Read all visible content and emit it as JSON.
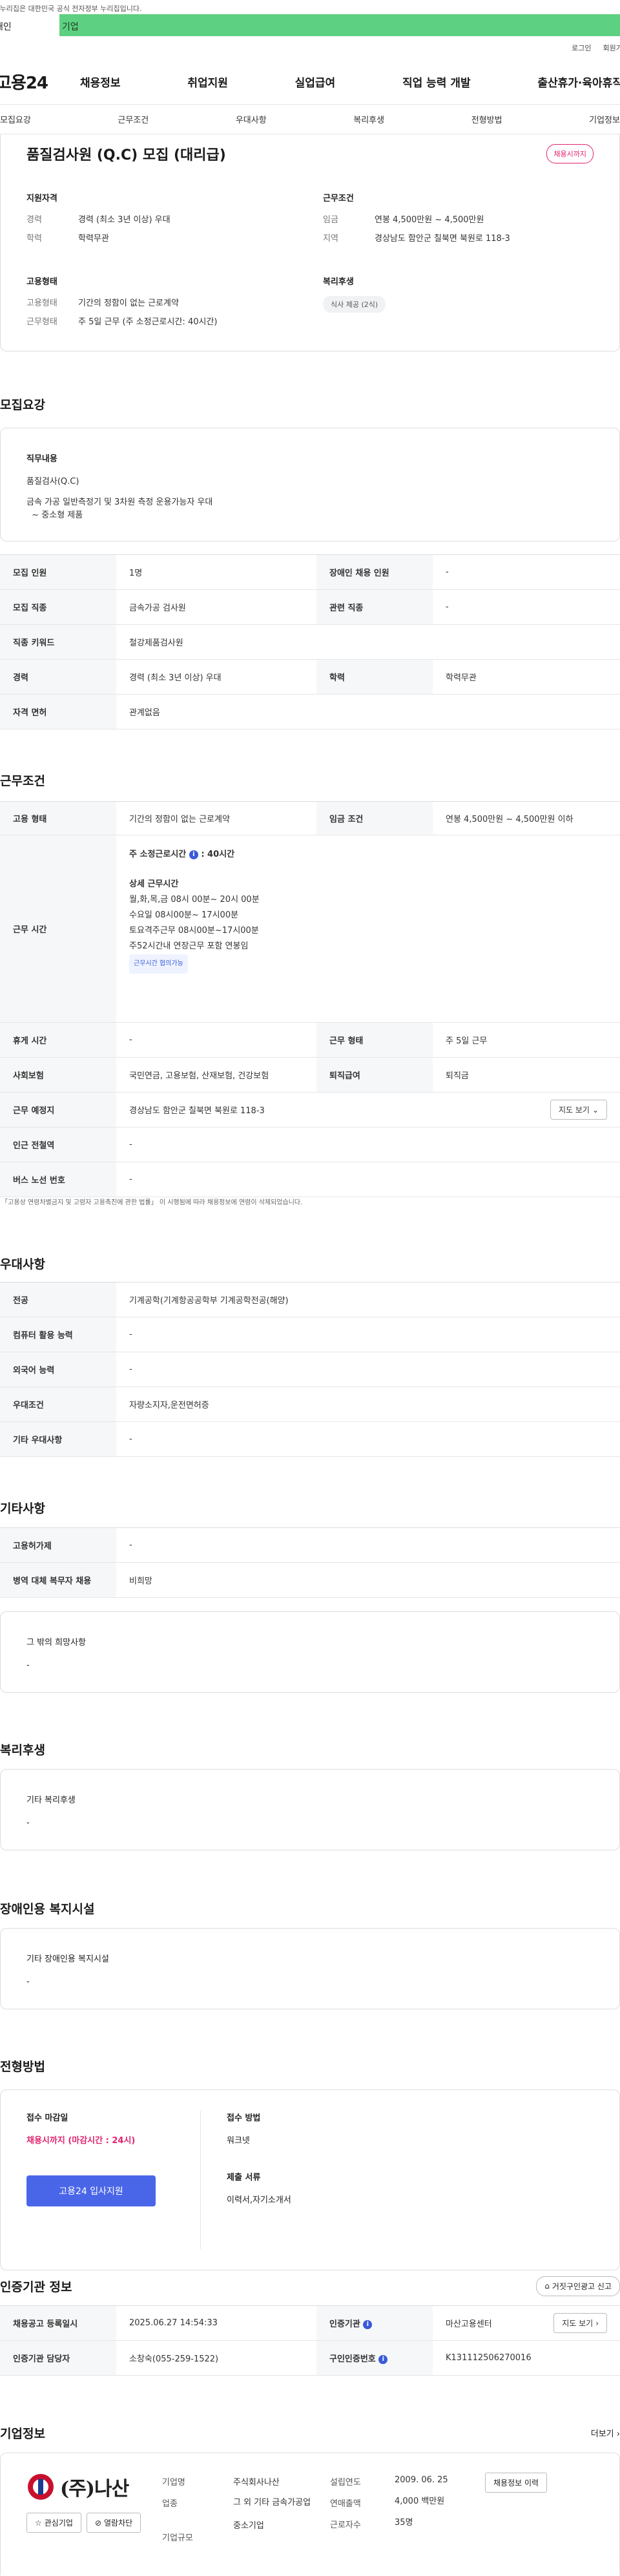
{
  "header": {
    "gov_banner": "이 누리집은 대한민국 공식 전자정부 누리집입니다.",
    "tab_personal": "개인",
    "tab_company": "기업",
    "util_login": "로그인",
    "util_join": "회원가입",
    "logo": "고용24",
    "menu": [
      "채용정보",
      "취업지원",
      "실업급여",
      "직업 능력 개발",
      "출산휴가·육아휴직"
    ]
  },
  "anchor_nav": [
    "모집요강",
    "근무조건",
    "우대사항",
    "복리후생",
    "전형방법",
    "기업정보"
  ],
  "summary": {
    "title": "품질검사원 (Q.C) 모집 (대리급)",
    "badge": "채용시까지",
    "qual_title": "지원자격",
    "qual_rows": [
      {
        "k": "경력",
        "v": "경력 (최소 3년 이상) 우대"
      },
      {
        "k": "학력",
        "v": "학력무관"
      }
    ],
    "cond_title": "근무조건",
    "cond_rows": [
      {
        "k": "임금",
        "v": "연봉 4,500만원 ~ 4,500만원"
      },
      {
        "k": "지역",
        "v": "경상남도 함안군 칠북면 북원로 118-3"
      }
    ],
    "emp_title": "고용형태",
    "emp_rows": [
      {
        "k": "고용형태",
        "v": "기간의 정함이 없는 근로계약"
      },
      {
        "k": "근무형태",
        "v": "주 5일 근무 (주 소정근로시간: 40시간)"
      }
    ],
    "welfare_title": "복리후생",
    "welfare_chip": "식사 제공 (2식)"
  },
  "recruit": {
    "section_title": "모집요강",
    "job_title": "직무내용",
    "job_lines": [
      "품질검사(Q.C)",
      "",
      "금속 가공 일반측정기 및 3차원 측정 운용가능자 우대",
      "  ~ 중소형 제품"
    ],
    "rows": [
      {
        "k1": "모집 인원",
        "v1": "1명",
        "k2": "장애인 채용 인원",
        "v2": "-"
      },
      {
        "k1": "모집 직종",
        "v1": "금속가공 검사원",
        "k2": "관련 직종",
        "v2": "-"
      },
      {
        "k1": "직종 키워드",
        "v1": "철강제품검사원",
        "k2": "",
        "v2": ""
      },
      {
        "k1": "경력",
        "v1": "경력 (최소 3년 이상) 우대",
        "k2": "학력",
        "v2": "학력무관"
      },
      {
        "k1": "자격 면허",
        "v1": "관계없음",
        "k2": "",
        "v2": ""
      }
    ]
  },
  "work": {
    "section_title": "근무조건",
    "r1": {
      "k1": "고용 형태",
      "v1": "기간의 정함이 없는 근로계약",
      "k2": "임금 조건",
      "v2": "연봉 4,500만원 ~ 4,500만원 이하"
    },
    "hours_label": "근무 시간",
    "hours_weekly": "주 소정근로시간",
    "hours_weekly_val": ": 40시간",
    "hours_detail_title": "상세 근무시간",
    "hours_lines": [
      "월,화,목,금 08시 00분~ 20시 00분",
      "수요일 08시00분~ 17시00분",
      "토요격주근무 08시00분~17시00분",
      "주52시간내 연장근무 포함 연봉임"
    ],
    "hours_chip": "근무시간 협의가능",
    "r3": {
      "k1": "휴게 시간",
      "v1": "-",
      "k2": "근무 형태",
      "v2": "주 5일 근무"
    },
    "r4": {
      "k1": "사회보험",
      "v1": "국민연금, 고용보험, 산재보험, 건강보험",
      "k2": "퇴직급여",
      "v2": "퇴직금"
    },
    "r5": {
      "k1": "근무 예정지",
      "v1": "경상남도 함안군 칠북면 북원로 118-3",
      "btn": "지도 보기"
    },
    "r6": {
      "k1": "인근 전철역",
      "v1": "-"
    },
    "r7": {
      "k1": "버스 노선 번호",
      "v1": "-"
    },
    "note": "* 「고용상 연령차별금지 및 고령자 고용촉진에 관한 법률」 이 시행됨에 따라 채용정보에 연령이 삭제되었습니다."
  },
  "pref": {
    "section_title": "우대사항",
    "rows": [
      {
        "k": "전공",
        "v": "기계공학(기계항공공학부 기계공학전공(해양)"
      },
      {
        "k": "컴퓨터 활용 능력",
        "v": "-"
      },
      {
        "k": "외국어 능력",
        "v": "-"
      },
      {
        "k": "우대조건",
        "v": "자량소지자,운전면허증"
      },
      {
        "k": "기타 우대사항",
        "v": "-"
      }
    ]
  },
  "etc": {
    "section_title": "기타사항",
    "rows": [
      {
        "k": "고용허가제",
        "v": "-"
      },
      {
        "k": "병역 대체 복무자 채용",
        "v": "비희망"
      }
    ],
    "box_title": "그 밖의 희망사항",
    "box_val": "-"
  },
  "welfare": {
    "section_title": "복리후생",
    "box_title": "기타 복리후생",
    "box_val": "-"
  },
  "disabled": {
    "section_title": "장애인용 복지시설",
    "box_title": "기타 장애인용 복지시설",
    "box_val": "-"
  },
  "selection": {
    "section_title": "전형방법",
    "deadline_label": "접수 마감일",
    "deadline_value": "채용시까지 (마감시간 : 24시)",
    "apply_btn": "고용24 입사지원",
    "method_label": "접수 방법",
    "method_value": "워크넷",
    "docs_label": "제출 서류",
    "docs_value": "이력서,자기소개서"
  },
  "agency": {
    "section_title": "인증기관 정보",
    "report_btn": "거짓구인광고 신고",
    "r1": {
      "k1": "채용공고 등록일시",
      "v1": "2025.06.27 14:54:33",
      "k2": "인증기관",
      "v2": "마산고용센터",
      "btn": "지도 보기"
    },
    "r2": {
      "k1": "인증기관 담당자",
      "v1": "소창숙(055-259-1522)",
      "k2": "구인인증번호",
      "v2": "K131112506270016"
    }
  },
  "company": {
    "section_title": "기업정보",
    "more": "더보기",
    "logo_text": "(주)나산",
    "fav_btn": "관심기업",
    "block_btn": "열람차단",
    "labels": [
      "기업명",
      "업종",
      "기업규모"
    ],
    "values": [
      "주식회사나산",
      "그 외 기타 금속가공업",
      "중소기업"
    ],
    "labels2": [
      "설립연도",
      "연매출액",
      "근로자수"
    ],
    "values2": [
      "2009. 06. 25",
      "4,000 백만원",
      "35명"
    ],
    "history_btn": "채용정보 이력"
  }
}
